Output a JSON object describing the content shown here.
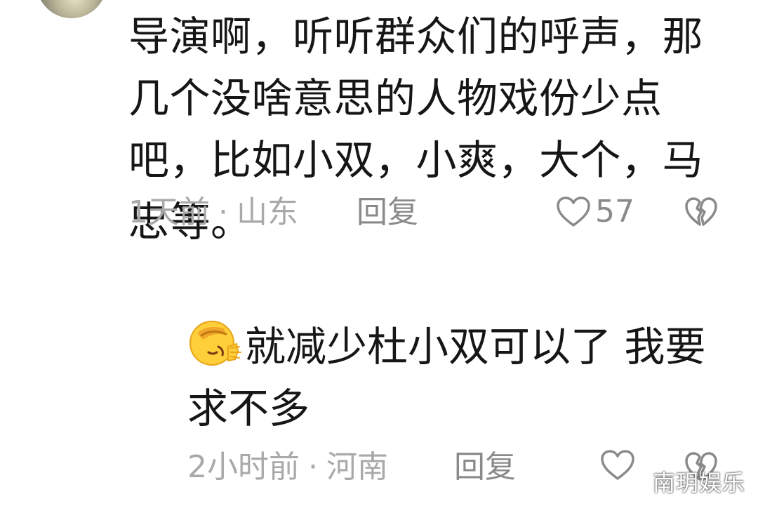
{
  "comment": {
    "text": "导演啊，听听群众们的呼声，那几个没啥意思的人物戏份少点吧，比如小双，小爽，大个，马忠等。",
    "time": "1天前",
    "location": "山东",
    "reply_label": "回复",
    "like_count": "57"
  },
  "reply": {
    "emoji": "facepalm-emoji",
    "text": "就减少杜小双可以了 我要求不多",
    "time": "2小时前",
    "location": "河南",
    "reply_label": "回复"
  },
  "separator": "·",
  "watermark": "南玥娱乐",
  "icons": {
    "like": "heart-outline-icon",
    "dislike": "broken-heart-icon"
  },
  "colors": {
    "text": "#161616",
    "meta": "#a9a9a9",
    "icon": "#8a8a8a"
  }
}
